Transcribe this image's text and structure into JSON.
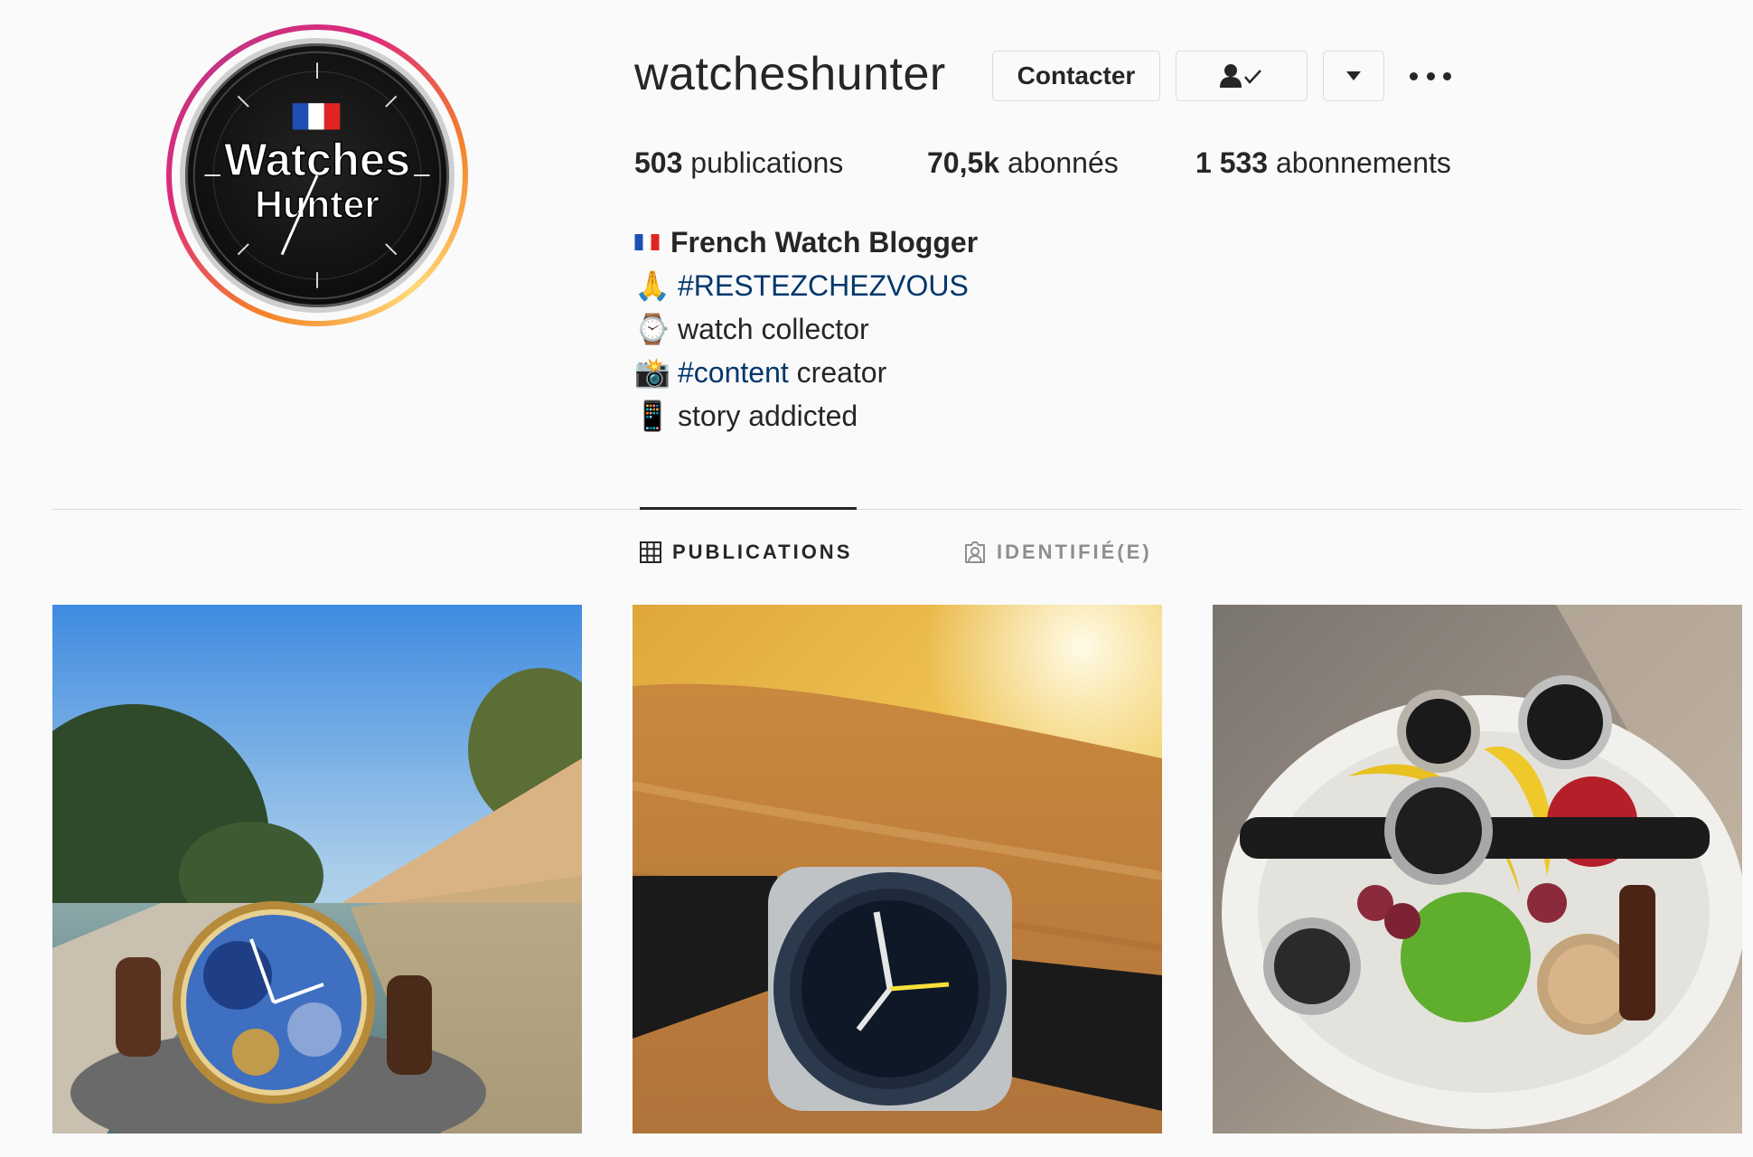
{
  "profile": {
    "username": "watcheshunter",
    "avatar_logo_line1": "Watches",
    "avatar_logo_line2": "Hunter"
  },
  "actions": {
    "contact_label": "Contacter",
    "following_icon": "person-check-icon",
    "dropdown_icon": "caret-down-icon",
    "more_icon": "ellipsis-icon"
  },
  "stats": {
    "posts_count": "503",
    "posts_label": " publications",
    "followers_count": "70,5k",
    "followers_label": " abonnés",
    "following_count": "1 533",
    "following_label": " abonnements"
  },
  "bio": {
    "name_emoji": "🇫🇷",
    "name": "French Watch Blogger",
    "line1_emoji": "🙏",
    "line1_hashtag": "#RESTEZCHEZVOUS",
    "line2_emoji": "⌚",
    "line2_text": "watch collector",
    "line3_emoji": "📸",
    "line3_hashtag": "#content",
    "line3_text": " creator",
    "line4_emoji": "📱",
    "line4_text": "story addicted"
  },
  "tabs": {
    "posts_label": "PUBLICATIONS",
    "tagged_label": "IDENTIFIÉ(E)",
    "active": "PUBLICATIONS"
  },
  "colors": {
    "text": "#262626",
    "muted": "#8e8e8e",
    "hashtag": "#00376b",
    "border": "#dbdbdb",
    "background": "#fafafa"
  }
}
